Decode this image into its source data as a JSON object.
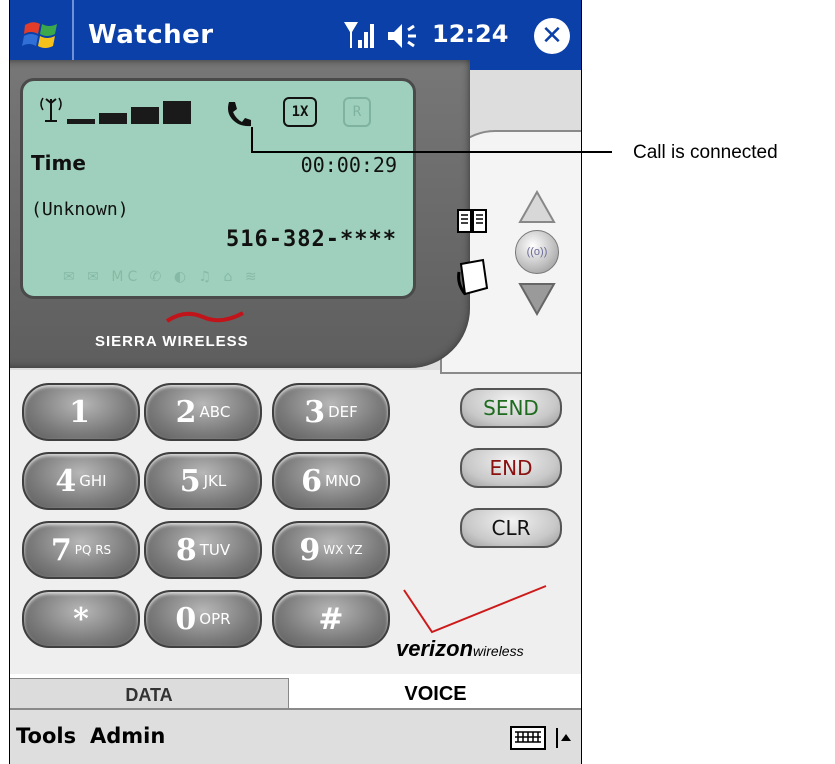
{
  "titlebar": {
    "app_title": "Watcher",
    "time": "12:24",
    "close_label": "✕"
  },
  "lcd": {
    "time_label": "Time",
    "time_value": "00:00:29",
    "caller_name": "(Unknown)",
    "caller_number": "516-382-****",
    "onex_label": "1X",
    "roam_label": "R",
    "status_icons": "✉ ✉ MC ✆ ◐ ♫ ⌂ ≋"
  },
  "branding": {
    "console_brand": "SIERRA WIRELESS",
    "carrier_big": "verizon",
    "carrier_small": "wireless"
  },
  "keypad": {
    "keys": [
      {
        "digit": "1",
        "letters": ""
      },
      {
        "digit": "2",
        "letters": "ABC"
      },
      {
        "digit": "3",
        "letters": "DEF"
      },
      {
        "digit": "4",
        "letters": "GHI"
      },
      {
        "digit": "5",
        "letters": "JKL"
      },
      {
        "digit": "6",
        "letters": "MNO"
      },
      {
        "digit": "7",
        "letters": "PQ RS"
      },
      {
        "digit": "8",
        "letters": "TUV"
      },
      {
        "digit": "9",
        "letters": "WX YZ"
      },
      {
        "digit": "*",
        "letters": ""
      },
      {
        "digit": "0",
        "letters": "OPR"
      },
      {
        "digit": "#",
        "letters": ""
      }
    ]
  },
  "call_buttons": {
    "send": "SEND",
    "end": "END",
    "clear": "CLR"
  },
  "colors": {
    "send": "#1f6b1f",
    "end": "#8b1010",
    "clear": "#111111",
    "titlebar": "#0a40a8"
  },
  "tabs": {
    "data": "DATA",
    "voice": "VOICE"
  },
  "menubar": {
    "tools": "Tools",
    "admin": "Admin"
  },
  "annotation": {
    "text": "Call is connected"
  }
}
